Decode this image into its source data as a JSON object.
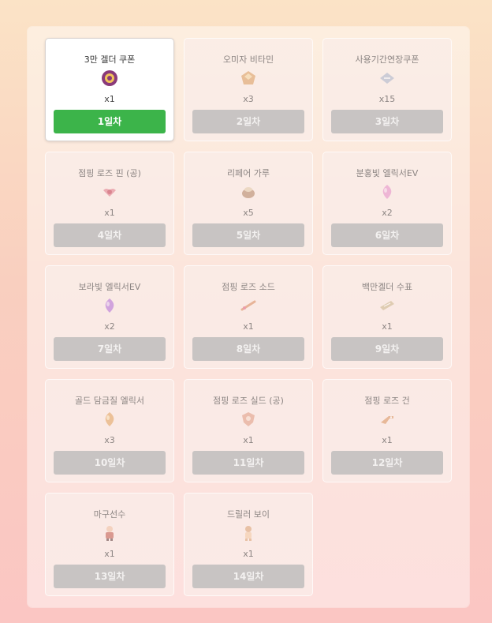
{
  "rewards": [
    {
      "name": "3만 겔더 쿠폰",
      "qty": "x1",
      "day": "1일차",
      "active": true,
      "icon": "gelder-coupon-icon",
      "color": "#8a3a7a"
    },
    {
      "name": "오미자 비타민",
      "qty": "x3",
      "day": "2일차",
      "active": false,
      "icon": "vitamin-icon",
      "color": "#d99a5a"
    },
    {
      "name": "사용기간연장쿠폰",
      "qty": "x15",
      "day": "3일차",
      "active": false,
      "icon": "ticket-icon",
      "color": "#a7b2c9"
    },
    {
      "name": "점핑 로즈 핀 (공)",
      "qty": "x1",
      "day": "4일차",
      "active": false,
      "icon": "rose-pin-icon",
      "color": "#e07a8a"
    },
    {
      "name": "리페어 가루",
      "qty": "x5",
      "day": "5일차",
      "active": false,
      "icon": "repair-powder-icon",
      "color": "#b08060"
    },
    {
      "name": "분홍빛 엘릭서EV",
      "qty": "x2",
      "day": "6일차",
      "active": false,
      "icon": "pink-elixir-icon",
      "color": "#e58bc8"
    },
    {
      "name": "보라빛 엘릭서EV",
      "qty": "x2",
      "day": "7일차",
      "active": false,
      "icon": "purple-elixir-icon",
      "color": "#b06ad8"
    },
    {
      "name": "점핑 로즈 소드",
      "qty": "x1",
      "day": "8일차",
      "active": false,
      "icon": "rose-sword-icon",
      "color": "#d9885a"
    },
    {
      "name": "백만겔더 수표",
      "qty": "x1",
      "day": "9일차",
      "active": false,
      "icon": "check-icon",
      "color": "#c9b48a"
    },
    {
      "name": "골드 담금질 엘릭서",
      "qty": "x3",
      "day": "10일차",
      "active": false,
      "icon": "gold-elixir-icon",
      "color": "#e2a05a"
    },
    {
      "name": "점핑 로즈 실드 (공)",
      "qty": "x1",
      "day": "11일차",
      "active": false,
      "icon": "rose-shield-icon",
      "color": "#e09a80"
    },
    {
      "name": "점핑 로즈 건",
      "qty": "x1",
      "day": "12일차",
      "active": false,
      "icon": "rose-gun-icon",
      "color": "#d9905a"
    },
    {
      "name": "마구선수",
      "qty": "x1",
      "day": "13일차",
      "active": false,
      "icon": "player-icon",
      "color": "#c0574a"
    },
    {
      "name": "드릴러 보이",
      "qty": "x1",
      "day": "14일차",
      "active": false,
      "icon": "driller-boy-icon",
      "color": "#d9a070"
    }
  ]
}
